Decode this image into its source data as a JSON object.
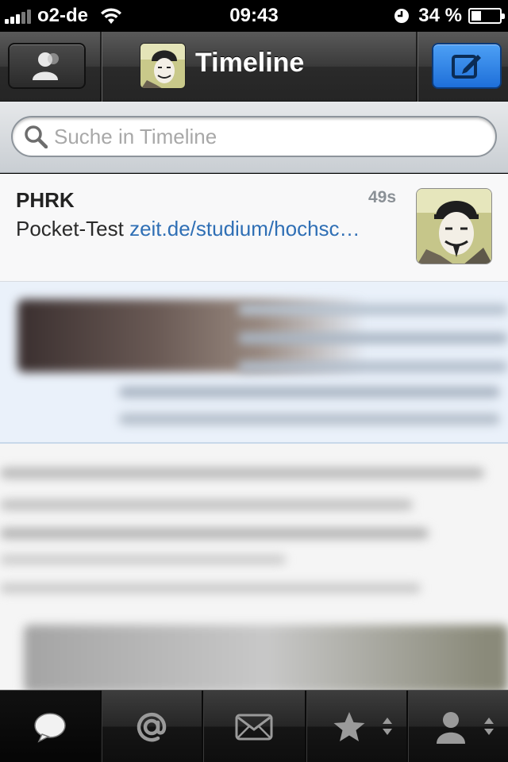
{
  "status_bar": {
    "carrier": "o2-de",
    "time": "09:43",
    "battery_percent": "34 %",
    "battery_level": 0.34,
    "signal_bars": 3
  },
  "nav": {
    "title": "Timeline",
    "left_button_icon": "people-icon",
    "right_button_icon": "compose-icon"
  },
  "search": {
    "placeholder": "Suche in Timeline",
    "value": ""
  },
  "tweets": [
    {
      "author": "PHRK",
      "age": "49s",
      "text": "Pocket-Test ",
      "link": "zeit.de/studium/hochsc…"
    }
  ],
  "tabbar": {
    "tabs": [
      {
        "icon": "speech-bubble-icon",
        "active": true
      },
      {
        "icon": "at-icon",
        "active": false
      },
      {
        "icon": "envelope-icon",
        "active": false
      },
      {
        "icon": "star-icon",
        "active": false
      },
      {
        "icon": "person-icon",
        "active": false
      }
    ]
  },
  "colors": {
    "accent_blue": "#1e6fd9",
    "link": "#2f6fb5"
  }
}
